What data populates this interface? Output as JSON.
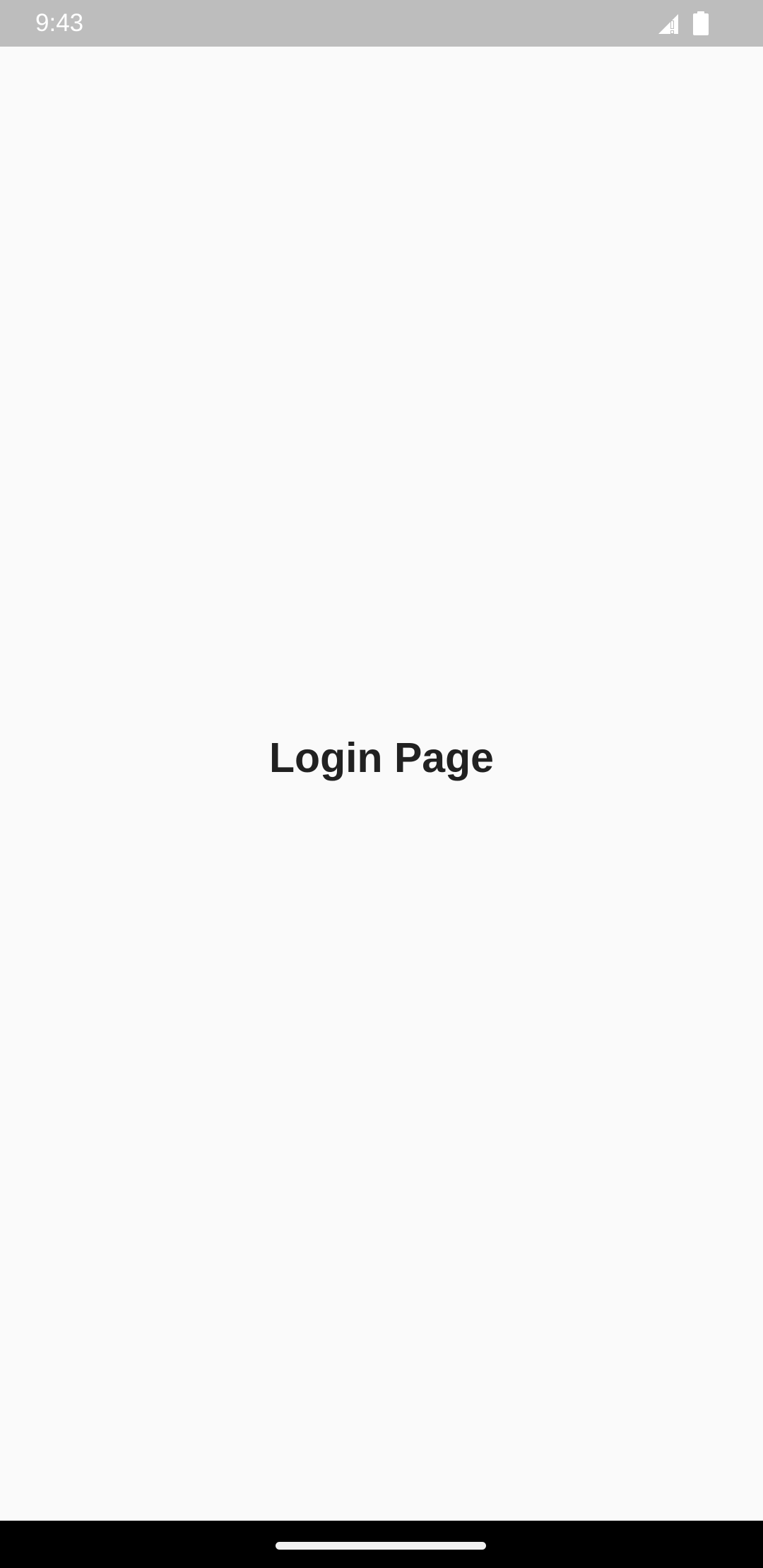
{
  "status_bar": {
    "time": "9:43",
    "icons": [
      "signal-icon",
      "battery-icon"
    ],
    "background_color": "#bdbdbd"
  },
  "main": {
    "title": "Login Page",
    "background_color": "#fafafa"
  },
  "navigation_bar": {
    "handle": "home-gesture-handle",
    "background_color": "#000000"
  }
}
